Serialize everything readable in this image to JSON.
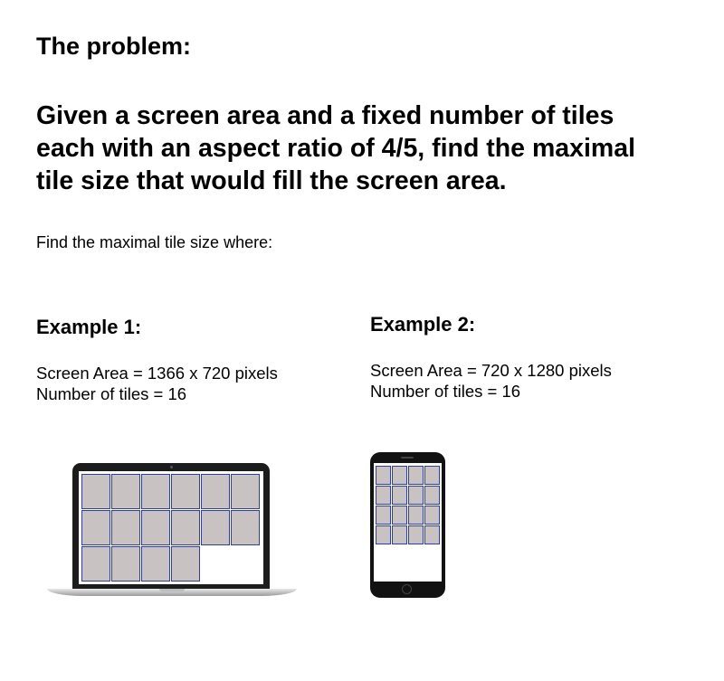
{
  "heading": "The problem:",
  "statement": {
    "line1": "Given a screen area and a fixed number of tiles",
    "line2": "each with an aspect ratio of 4/5, find the maximal",
    "line3": "tile size that would fill the screen area."
  },
  "find_text": "Find the maximal tile size where:",
  "examples": [
    {
      "title": "Example 1:",
      "screen_area": "Screen Area = 1366 x 720 pixels",
      "tiles": "Number of tiles = 16",
      "device": "laptop-icon"
    },
    {
      "title": "Example 2:",
      "screen_area": "Screen Area = 720 x 1280 pixels",
      "tiles": "Number of tiles = 16",
      "device": "phone-icon"
    }
  ],
  "colors": {
    "tile_fill": "#c8c2c2",
    "tile_border": "#2f3f9a",
    "device_dark": "#1c1c1c"
  }
}
